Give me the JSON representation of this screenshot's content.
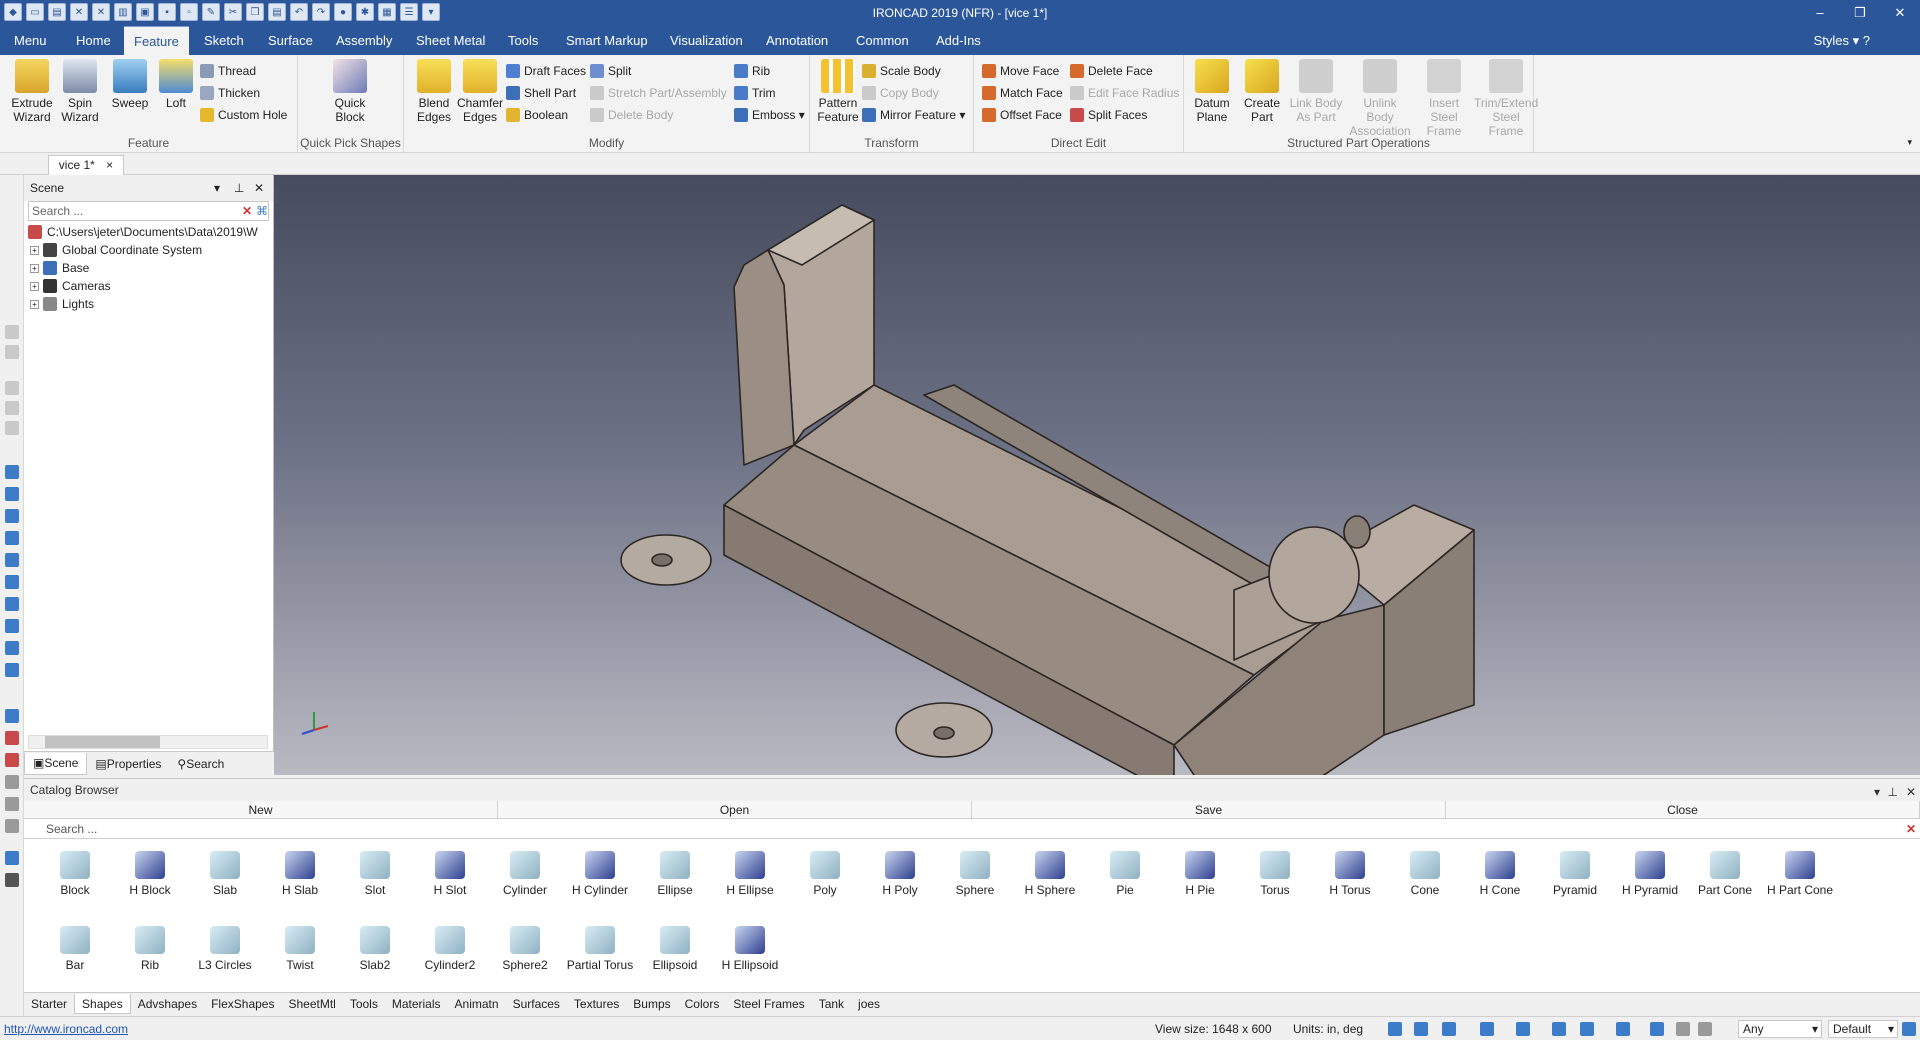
{
  "titlebar": {
    "title": "IRONCAD 2019 (NFR) - [vice 1*]",
    "minimize": "–",
    "restore": "❐",
    "close": "✕"
  },
  "ribbon_tabs": [
    "Menu",
    "Home",
    "Feature",
    "Sketch",
    "Surface",
    "Assembly",
    "Sheet Metal",
    "Tools",
    "Smart Markup",
    "Visualization",
    "Annotation",
    "Common",
    "Add-Ins"
  ],
  "styles_label": "Styles",
  "feature_group": {
    "label": "Feature",
    "extrude": "Extrude\nWizard",
    "spin": "Spin\nWizard",
    "sweep": "Sweep",
    "loft": "Loft",
    "thread": "Thread",
    "thicken": "Thicken",
    "custom_hole": "Custom Hole"
  },
  "quickpick_group": {
    "label": "Quick Pick Shapes",
    "quick_block": "Quick\nBlock"
  },
  "modify_group": {
    "label": "Modify",
    "blend": "Blend\nEdges",
    "chamfer": "Chamfer\nEdges",
    "draft_faces": "Draft Faces",
    "shell_part": "Shell Part",
    "boolean": "Boolean",
    "split": "Split",
    "stretch": "Stretch Part/Assembly",
    "delete_body": "Delete Body",
    "rib": "Rib",
    "trim": "Trim",
    "emboss": "Emboss"
  },
  "transform_group": {
    "label": "Transform",
    "pattern": "Pattern\nFeature",
    "scale_body": "Scale Body",
    "copy_body": "Copy Body",
    "mirror": "Mirror Feature"
  },
  "directedit_group": {
    "label": "Direct Edit",
    "move_face": "Move Face",
    "match_face": "Match Face",
    "offset_face": "Offset Face",
    "delete_face": "Delete Face",
    "edit_face_radius": "Edit Face Radius",
    "split_faces": "Split Faces"
  },
  "structured_group": {
    "label": "Structured Part Operations",
    "datum_plane": "Datum\nPlane",
    "create_part": "Create\nPart",
    "link_body": "Link Body\nAs Part",
    "unlink_body": "Unlink Body\nAssociation",
    "insert_steel": "Insert Steel\nFrame",
    "trim_steel": "Trim/Extend\nSteel Frame"
  },
  "doc_tab": "vice 1*",
  "scene": {
    "title": "Scene",
    "search_placeholder": "Search ...",
    "path": "C:\\Users\\jeter\\Documents\\Data\\2019\\W",
    "items": [
      "Global Coordinate System",
      "Base",
      "Cameras",
      "Lights"
    ],
    "tabs": [
      "Scene",
      "Properties",
      "Search"
    ]
  },
  "catalog": {
    "title": "Catalog Browser",
    "actions": [
      "New",
      "Open",
      "Save",
      "Close"
    ],
    "search_placeholder": "Search ...",
    "row1": [
      "Block",
      "H Block",
      "Slab",
      "H Slab",
      "Slot",
      "H Slot",
      "Cylinder",
      "H Cylinder",
      "Ellipse",
      "H Ellipse",
      "Poly",
      "H Poly",
      "Sphere",
      "H Sphere",
      "Pie",
      "H Pie",
      "Torus",
      "H Torus",
      "Cone",
      "H Cone",
      "Pyramid",
      "H Pyramid",
      "Part Cone",
      "H Part Cone"
    ],
    "row2": [
      "Bar",
      "Rib",
      "L3 Circles",
      "Twist",
      "Slab2",
      "Cylinder2",
      "Sphere2",
      "Partial Torus",
      "Ellipsoid",
      "H Ellipsoid"
    ],
    "tabs": [
      "Starter",
      "Shapes",
      "Advshapes",
      "FlexShapes",
      "SheetMtl",
      "Tools",
      "Materials",
      "Animatn",
      "Surfaces",
      "Textures",
      "Bumps",
      "Colors",
      "Steel Frames",
      "Tank",
      "joes"
    ]
  },
  "status": {
    "url": "http://www.ironcad.com",
    "view_size": "View size: 1648 x 600",
    "units": "Units: in, deg",
    "filter": "Any",
    "style": "Default"
  },
  "colors": {
    "title_bg": "#2b579a",
    "model": "#a1958c",
    "icon_yellow": "#f2c230",
    "icon_blue": "#3d7cc8"
  }
}
